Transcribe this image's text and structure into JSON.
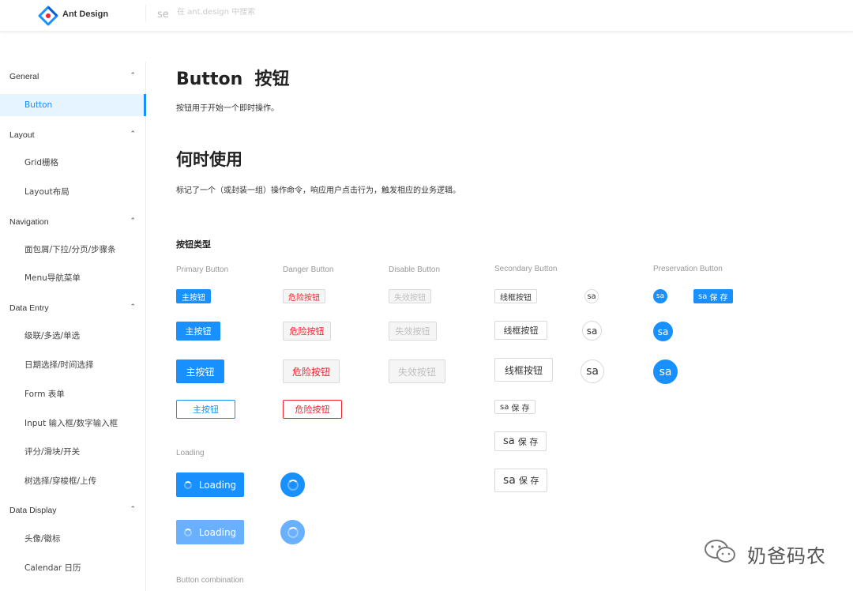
{
  "header": {
    "app_title": "Ant Design",
    "search_icon_text": "se",
    "search_placeholder": "在 ant.design 中搜索"
  },
  "sidebar": {
    "groups": [
      {
        "title": "General",
        "items": [
          "Button"
        ]
      },
      {
        "title": "Layout",
        "items": [
          "Grid栅格",
          "Layout布局"
        ]
      },
      {
        "title": "Navigation",
        "items": [
          "面包屑/下拉/分页/步骤条",
          "Menu导航菜单"
        ]
      },
      {
        "title": "Data Entry",
        "items": [
          "级联/多选/单选",
          "日期选择/时间选择",
          "Form 表单",
          "Input 输入框/数字输入框",
          "评分/滑块/开关",
          "树选择/穿梭框/上传"
        ]
      },
      {
        "title": "Data Display",
        "items": [
          "头像/徽标",
          "Calendar 日历"
        ]
      }
    ],
    "active_item": "Button",
    "chevron": "⌃"
  },
  "content": {
    "title": "Button  按钮",
    "intro": "按钮用于开始一个即时操作。",
    "when_title": "何时使用",
    "when_desc": "标记了一个（或封装一组）操作命令，响应用户点击行为，触发相应的业务逻辑。",
    "types_title": "按钮类型",
    "columns": {
      "primary": "Primary Button",
      "danger": "Danger Button",
      "disable": "Disable Button",
      "secondary": "Secondary Button",
      "preservation": "Preservation Button"
    },
    "primary_label": "主按钮",
    "danger_label": "危险按钮",
    "disable_label": "失效按钮",
    "secondary_label": "线框按钮",
    "icon_label": "sa",
    "save_label": "保 存",
    "loading_title": "Loading",
    "loading_label": "Loading",
    "combination_title": "Button combination"
  },
  "watermark": "奶爸码农",
  "colors": {
    "primary": "#1890ff",
    "danger": "#f5222d",
    "active_bg": "#e6f4ff"
  }
}
